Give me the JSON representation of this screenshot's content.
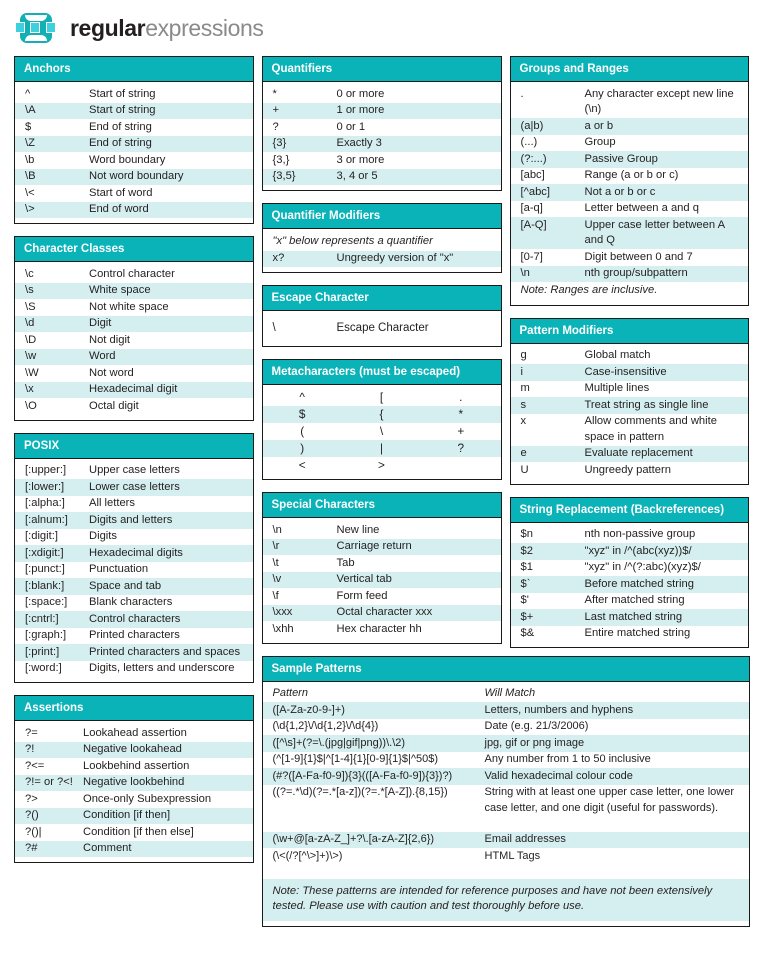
{
  "brand": {
    "word1": "regular",
    "word2": "expressions",
    "logo_icon": "regex-logo-icon"
  },
  "colors": {
    "header_teal": "#0ab3b8",
    "row_alt": "#d5eff0",
    "text": "#231f20",
    "logo_teal": "#12b0b5"
  },
  "cards": {
    "anchors": {
      "title": "Anchors",
      "rows": [
        {
          "k": "^",
          "v": "Start of string"
        },
        {
          "k": "\\A",
          "v": "Start of string"
        },
        {
          "k": "$",
          "v": "End of string"
        },
        {
          "k": "\\Z",
          "v": "End of string"
        },
        {
          "k": "\\b",
          "v": "Word boundary"
        },
        {
          "k": "\\B",
          "v": "Not word boundary"
        },
        {
          "k": "\\<",
          "v": "Start of word"
        },
        {
          "k": "\\>",
          "v": "End of word"
        }
      ]
    },
    "character_classes": {
      "title": "Character Classes",
      "rows": [
        {
          "k": "\\c",
          "v": "Control character"
        },
        {
          "k": "\\s",
          "v": "White space"
        },
        {
          "k": "\\S",
          "v": "Not white space"
        },
        {
          "k": "\\d",
          "v": "Digit"
        },
        {
          "k": "\\D",
          "v": "Not digit"
        },
        {
          "k": "\\w",
          "v": "Word"
        },
        {
          "k": "\\W",
          "v": "Not word"
        },
        {
          "k": "\\x",
          "v": "Hexadecimal digit"
        },
        {
          "k": "\\O",
          "v": "Octal digit"
        }
      ]
    },
    "posix": {
      "title": "POSIX",
      "rows": [
        {
          "k": "[:upper:]",
          "v": "Upper case letters"
        },
        {
          "k": "[:lower:]",
          "v": "Lower case letters"
        },
        {
          "k": "[:alpha:]",
          "v": "All letters"
        },
        {
          "k": "[:alnum:]",
          "v": "Digits and letters"
        },
        {
          "k": "[:digit:]",
          "v": "Digits"
        },
        {
          "k": "[:xdigit:]",
          "v": "Hexadecimal digits"
        },
        {
          "k": "[:punct:]",
          "v": "Punctuation"
        },
        {
          "k": "[:blank:]",
          "v": "Space and tab"
        },
        {
          "k": "[:space:]",
          "v": "Blank characters"
        },
        {
          "k": "[:cntrl:]",
          "v": "Control characters"
        },
        {
          "k": "[:graph:]",
          "v": "Printed characters"
        },
        {
          "k": "[:print:]",
          "v": "Printed characters and spaces"
        },
        {
          "k": "[:word:]",
          "v": "Digits, letters and underscore"
        }
      ]
    },
    "assertions": {
      "title": "Assertions",
      "rows": [
        {
          "k": "?=",
          "v": "Lookahead assertion"
        },
        {
          "k": "?!",
          "v": "Negative lookahead"
        },
        {
          "k": "?<=",
          "v": "Lookbehind assertion"
        },
        {
          "k": "?!= or ?<!",
          "v": "Negative lookbehind"
        },
        {
          "k": "?>",
          "v": "Once-only Subexpression"
        },
        {
          "k": "?()",
          "v": "Condition [if then]"
        },
        {
          "k": "?()|",
          "v": "Condition [if then else]"
        },
        {
          "k": "?#",
          "v": "Comment"
        }
      ]
    },
    "quantifiers": {
      "title": "Quantifiers",
      "rows": [
        {
          "k": "*",
          "v": "0 or more"
        },
        {
          "k": "+",
          "v": "1 or more"
        },
        {
          "k": "?",
          "v": "0 or 1"
        },
        {
          "k": "{3}",
          "v": "Exactly 3"
        },
        {
          "k": "{3,}",
          "v": "3 or more"
        },
        {
          "k": "{3,5}",
          "v": "3, 4 or 5"
        }
      ]
    },
    "quantifier_modifiers": {
      "title": "Quantifier Modifiers",
      "note": "\"x\" below represents a quantifier",
      "rows": [
        {
          "k": "x?",
          "v": "Ungreedy version of \"x\""
        }
      ]
    },
    "escape_character": {
      "title": "Escape Character",
      "rows": [
        {
          "k": "\\",
          "v": "Escape Character"
        }
      ]
    },
    "metacharacters": {
      "title": "Metacharacters (must be escaped)",
      "grid": [
        [
          "^",
          "[",
          "."
        ],
        [
          "$",
          "{",
          "*"
        ],
        [
          "(",
          "\\",
          "+"
        ],
        [
          ")",
          "|",
          "?"
        ],
        [
          "<",
          ">",
          ""
        ]
      ]
    },
    "special_characters": {
      "title": "Special Characters",
      "rows": [
        {
          "k": "\\n",
          "v": "New line"
        },
        {
          "k": "\\r",
          "v": "Carriage return"
        },
        {
          "k": "\\t",
          "v": "Tab"
        },
        {
          "k": "\\v",
          "v": "Vertical tab"
        },
        {
          "k": "\\f",
          "v": "Form feed"
        },
        {
          "k": "\\xxx",
          "v": "Octal character xxx"
        },
        {
          "k": "\\xhh",
          "v": "Hex character hh"
        }
      ]
    },
    "groups_and_ranges": {
      "title": "Groups and Ranges",
      "rows": [
        {
          "k": ".",
          "v": "Any character except new line (\\n)"
        },
        {
          "k": "(a|b)",
          "v": "a or b"
        },
        {
          "k": "(...)",
          "v": "Group"
        },
        {
          "k": "(?:...)",
          "v": "Passive Group"
        },
        {
          "k": "[abc]",
          "v": "Range (a or b or c)"
        },
        {
          "k": "[^abc]",
          "v": "Not a or b or c"
        },
        {
          "k": "[a-q]",
          "v": "Letter between a and q"
        },
        {
          "k": "[A-Q]",
          "v": "Upper case letter between A and Q"
        },
        {
          "k": "[0-7]",
          "v": "Digit between 0 and 7"
        },
        {
          "k": "\\n",
          "v": "nth group/subpattern"
        }
      ],
      "note": "Note: Ranges are inclusive."
    },
    "pattern_modifiers": {
      "title": "Pattern Modifiers",
      "rows": [
        {
          "k": "g",
          "v": "Global match"
        },
        {
          "k": "i",
          "v": "Case-insensitive"
        },
        {
          "k": "m",
          "v": "Multiple lines"
        },
        {
          "k": "s",
          "v": "Treat string as single line"
        },
        {
          "k": "x",
          "v": "Allow comments and white space in pattern"
        },
        {
          "k": "e",
          "v": "Evaluate replacement"
        },
        {
          "k": "U",
          "v": "Ungreedy pattern"
        }
      ]
    },
    "string_replacement": {
      "title": "String Replacement (Backreferences)",
      "rows": [
        {
          "k": "$n",
          "v": "nth non-passive group"
        },
        {
          "k": "$2",
          "v": "\"xyz\" in /^(abc(xyz))$/"
        },
        {
          "k": "$1",
          "v": "\"xyz\" in /^(?:abc)(xyz)$/"
        },
        {
          "k": "$`",
          "v": "Before matched string"
        },
        {
          "k": "$'",
          "v": "After matched string"
        },
        {
          "k": "$+",
          "v": "Last matched string"
        },
        {
          "k": "$&",
          "v": "Entire matched string"
        }
      ]
    },
    "sample_patterns": {
      "title": "Sample Patterns",
      "col_pattern": "Pattern",
      "col_match": "Will Match",
      "rows": [
        {
          "p": "([A-Za-z0-9-]+)",
          "m": "Letters, numbers and hyphens"
        },
        {
          "p": "(\\d{1,2}\\/\\d{1,2}\\/\\d{4})",
          "m": "Date (e.g. 21/3/2006)"
        },
        {
          "p": "([^\\s]+(?=\\.(jpg|gif|png))\\.\\2)",
          "m": "jpg, gif or png image"
        },
        {
          "p": "(^[1-9]{1}$|^[1-4]{1}[0-9]{1}$|^50$)",
          "m": "Any number from 1 to 50 inclusive"
        },
        {
          "p": "(#?([A-Fa-f0-9]){3}(([A-Fa-f0-9]){3})?)",
          "m": "Valid hexadecimal colour code"
        },
        {
          "p": "((?=.*\\d)(?=.*[a-z])(?=.*[A-Z]).{8,15})",
          "m": "String with at least one upper case letter, one lower case letter, and one digit (useful for passwords)."
        },
        {
          "p": "(\\w+@[a-zA-Z_]+?\\.[a-zA-Z]{2,6})",
          "m": "Email addresses"
        },
        {
          "p": "(\\<(/?[^\\>]+)\\>)",
          "m": "HTML Tags"
        }
      ],
      "note": "Note: These patterns are intended for reference purposes and have not been extensively tested. Please use with caution and test thoroughly before use."
    }
  }
}
